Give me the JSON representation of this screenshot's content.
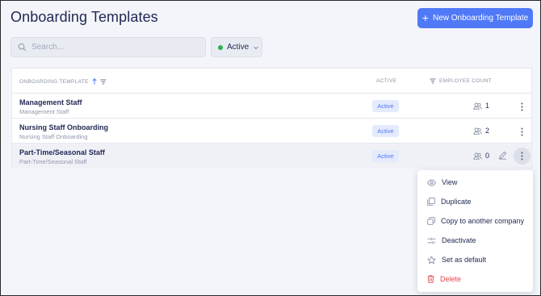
{
  "header": {
    "title": "Onboarding Templates",
    "new_button_label": "New Onboarding Template"
  },
  "filters": {
    "search_placeholder": "Search...",
    "status_label": "Active"
  },
  "table": {
    "columns": {
      "template": "ONBOARDING TEMPLATE",
      "active": "ACTIVE",
      "employee_count": "EMPLOYEE COUNT"
    },
    "rows": [
      {
        "title": "Management Staff",
        "subtitle": "Management Staff",
        "status": "Active",
        "count": "1"
      },
      {
        "title": "Nursing Staff Onboarding",
        "subtitle": "Nursing Staff Onboarding",
        "status": "Active",
        "count": "2"
      },
      {
        "title": "Part-Time/Seasonal Staff",
        "subtitle": "Part-Time/Seasonal Staff",
        "status": "Active",
        "count": "0"
      }
    ]
  },
  "menu": {
    "items": [
      {
        "label": "View",
        "icon": "eye-icon"
      },
      {
        "label": "Duplicate",
        "icon": "duplicate-icon"
      },
      {
        "label": "Copy to another company",
        "icon": "copy-icon"
      },
      {
        "label": "Deactivate",
        "icon": "deactivate-icon"
      },
      {
        "label": "Set as default",
        "icon": "star-icon"
      },
      {
        "label": "Delete",
        "icon": "trash-icon"
      }
    ]
  },
  "colors": {
    "accent": "#4f79f7",
    "active_dot": "#2bb24c",
    "danger": "#e5484d",
    "text": "#1f2752"
  }
}
